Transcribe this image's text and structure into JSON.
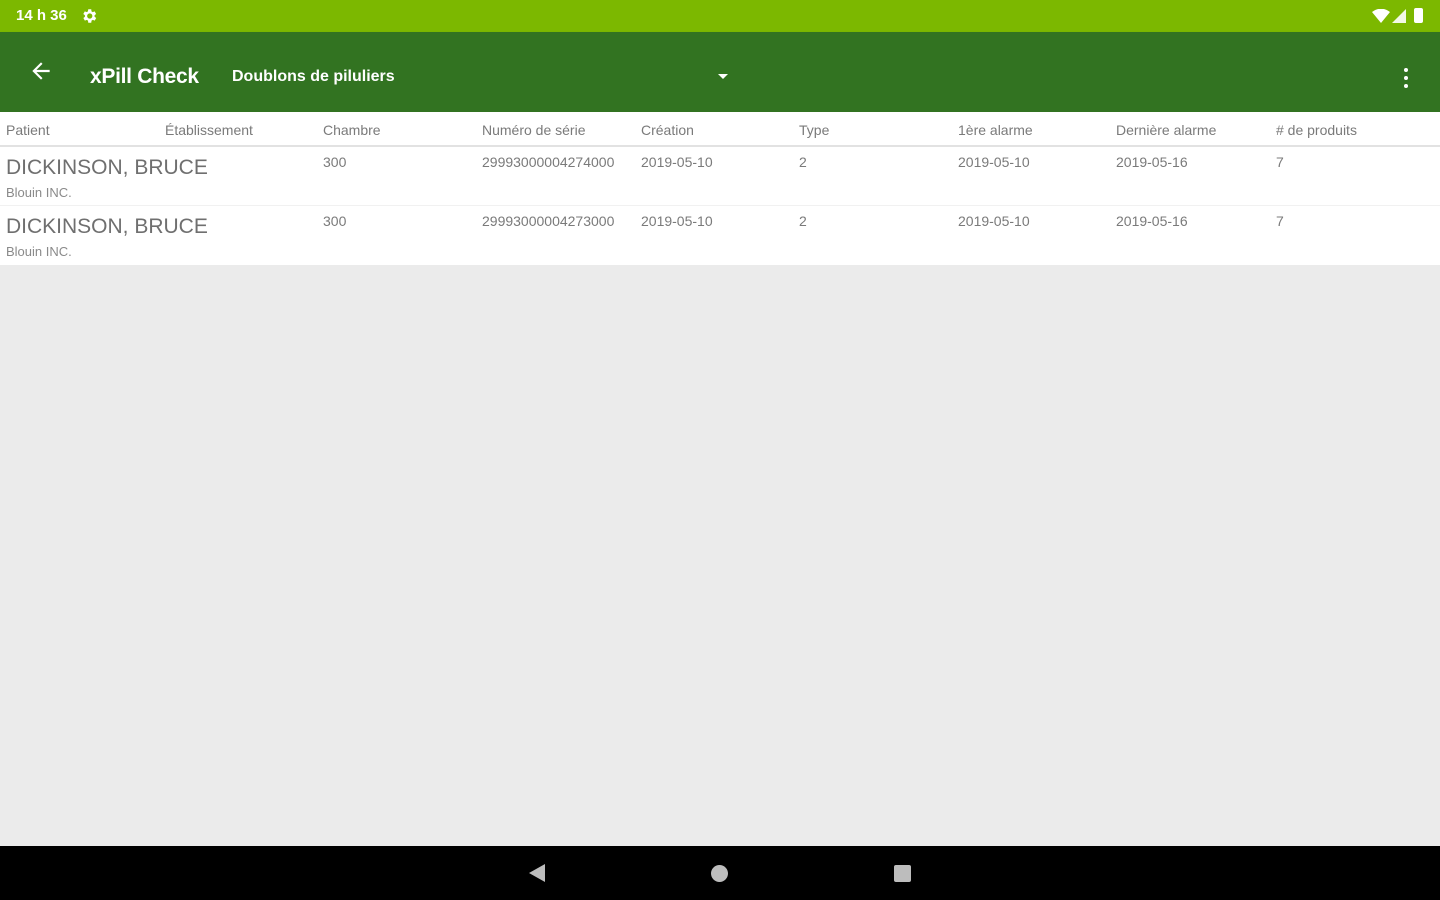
{
  "status_bar": {
    "time": "14 h 36",
    "icons": [
      "settings-icon",
      "wifi-icon",
      "signal-icon",
      "battery-icon"
    ]
  },
  "app_bar": {
    "title": "xPill Check",
    "spinner_value": "Doublons de piluliers",
    "colors": {
      "app_bar": "#327321",
      "status_bar": "#7cb800"
    }
  },
  "table": {
    "columns": [
      "Patient",
      "Établissement",
      "Chambre",
      "Numéro de série",
      "Création",
      "Type",
      "1ère alarme",
      "Dernière alarme",
      "# de produits"
    ],
    "rows": [
      {
        "patient": "DICKINSON, BRUCE",
        "facility": "Blouin INC.",
        "room": "300",
        "serial": "29993000004274000",
        "created": "2019-05-10",
        "type": "2",
        "first_alarm": "2019-05-10",
        "last_alarm": "2019-05-16",
        "products": "7"
      },
      {
        "patient": "DICKINSON, BRUCE",
        "facility": "Blouin INC.",
        "room": "300",
        "serial": "29993000004273000",
        "created": "2019-05-10",
        "type": "2",
        "first_alarm": "2019-05-10",
        "last_alarm": "2019-05-16",
        "products": "7"
      }
    ]
  },
  "nav_bar": {
    "icons": [
      "back-icon",
      "home-icon",
      "recents-icon"
    ]
  }
}
